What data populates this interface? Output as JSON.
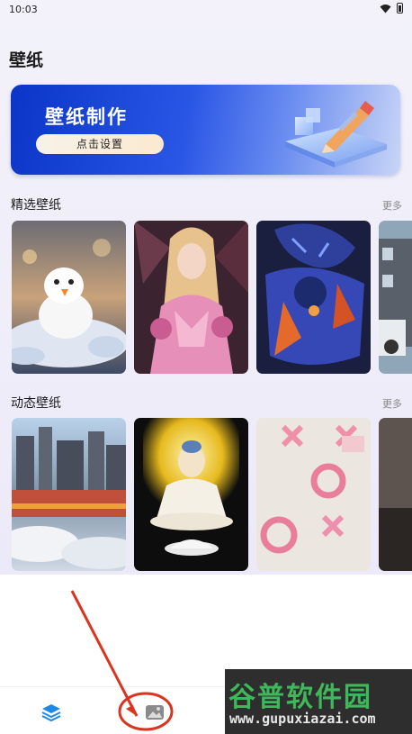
{
  "status_bar": {
    "time": "10:03",
    "wifi_icon": "wifi-icon",
    "battery_icon": "battery-icon"
  },
  "page": {
    "title": "壁纸"
  },
  "banner": {
    "title": "壁纸制作",
    "button_label": "点击设置",
    "art_icon": "pencil-cube-3d-icon"
  },
  "sections": {
    "featured": {
      "title": "精选壁纸",
      "more_label": "更多",
      "thumbnails": [
        "snowman-wallpaper",
        "pink-armor-girl-wallpaper",
        "blue-dragon-warrior-wallpaper",
        "city-car-wallpaper"
      ]
    },
    "dynamic": {
      "title": "动态壁纸",
      "more_label": "更多",
      "thumbnails": [
        "sky-city-wallpaper",
        "buddha-wallpaper",
        "pink-xo-wallpaper",
        "dark-landscape-wallpaper"
      ]
    }
  },
  "bottom_nav": {
    "items": [
      {
        "icon": "layers-icon",
        "active": true
      },
      {
        "icon": "image-icon",
        "active": false
      }
    ]
  },
  "watermark": {
    "text": "谷普软件园",
    "url": "www.gupuxiazai.com"
  },
  "colors": {
    "accent": "#1e88e5",
    "banner_blue": "#0a35c6",
    "annotation_red": "#d9341f",
    "watermark_green": "#3eb85a"
  }
}
